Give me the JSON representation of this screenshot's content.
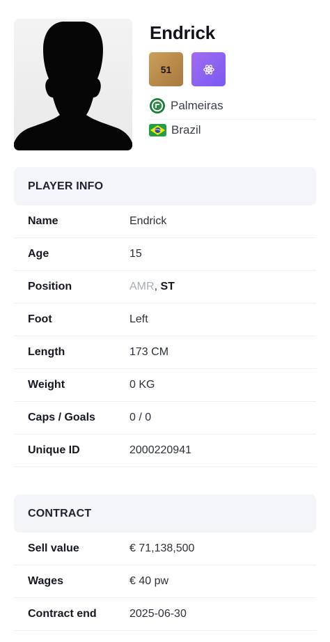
{
  "player": {
    "name": "Endrick",
    "rating": "51",
    "club": "Palmeiras",
    "country": "Brazil",
    "role_icon": "atom-icon",
    "club_icon": "club-crest-icon",
    "country_icon": "brazil-flag-icon"
  },
  "player_info": {
    "title": "PLAYER INFO",
    "rows": [
      {
        "label": "Name",
        "value": "Endrick"
      },
      {
        "label": "Age",
        "value": "15"
      },
      {
        "label": "Position",
        "value_secondary": "AMR",
        "value_sep": ", ",
        "value_primary": "ST"
      },
      {
        "label": "Foot",
        "value": "Left"
      },
      {
        "label": "Length",
        "value": "173 CM"
      },
      {
        "label": "Weight",
        "value": "0 KG"
      },
      {
        "label": "Caps / Goals",
        "value": "0 / 0"
      },
      {
        "label": "Unique ID",
        "value": "2000220941"
      }
    ]
  },
  "contract": {
    "title": "CONTRACT",
    "rows": [
      {
        "label": "Sell value",
        "value": "€ 71,138,500"
      },
      {
        "label": "Wages",
        "value": "€ 40 pw"
      },
      {
        "label": "Contract end",
        "value": "2025-06-30"
      }
    ]
  },
  "colors": {
    "rating_badge": "#b8894a",
    "role_badge": "#8a63f1",
    "section_header_bg": "#f4f5f8",
    "secondary_position": "#a9adb7"
  }
}
